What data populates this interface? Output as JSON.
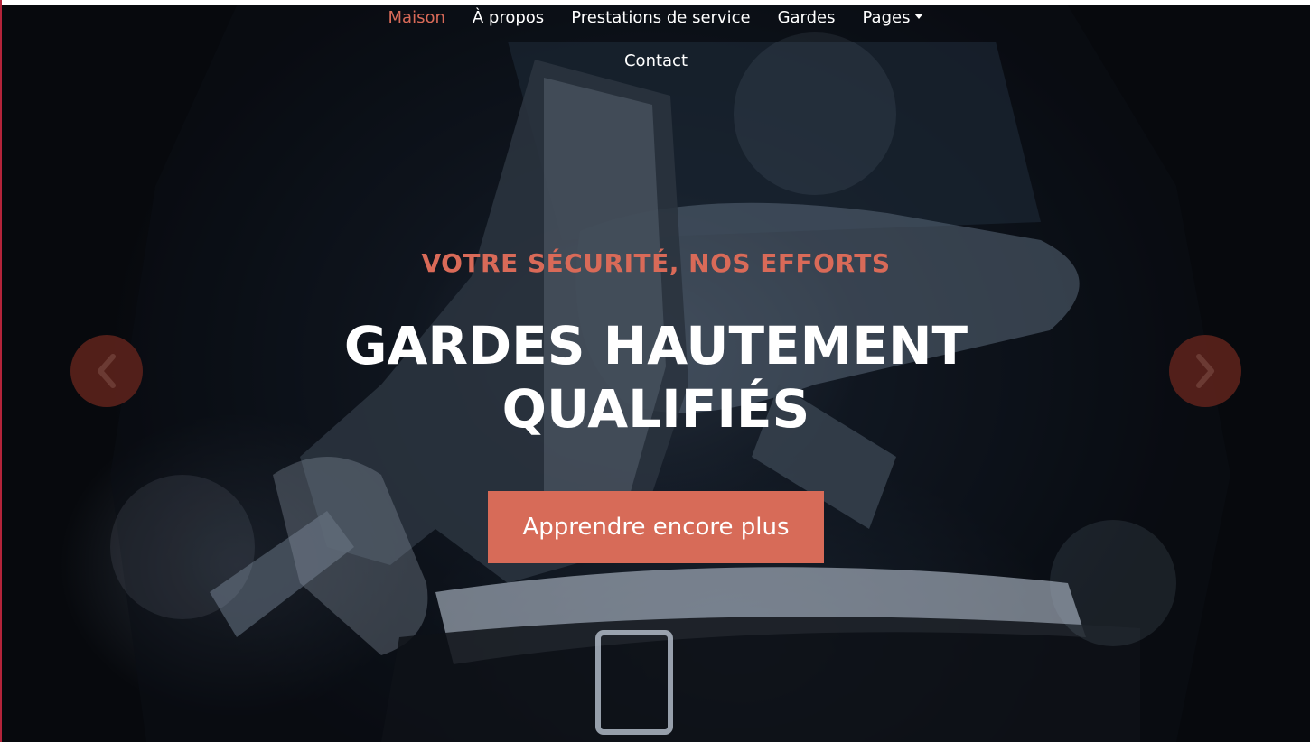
{
  "nav": {
    "items": [
      {
        "label": "Maison",
        "active": true
      },
      {
        "label": "À propos"
      },
      {
        "label": "Prestations de service"
      },
      {
        "label": "Gardes"
      },
      {
        "label": "Pages",
        "has_dropdown": true
      },
      {
        "label": "Contact"
      }
    ]
  },
  "hero": {
    "eyebrow": "VOTRE SÉCURITÉ, NOS EFFORTS",
    "headline": "GARDES HAUTEMENT QUALIFIÉS",
    "cta_label": "Apprendre encore plus",
    "prev_icon": "chevron-left-icon",
    "next_icon": "chevron-right-icon"
  },
  "colors": {
    "accent": "#d96a58",
    "cta_bg": "#d76b58",
    "arrow_bg": "#5f231c",
    "text": "#ffffff"
  }
}
